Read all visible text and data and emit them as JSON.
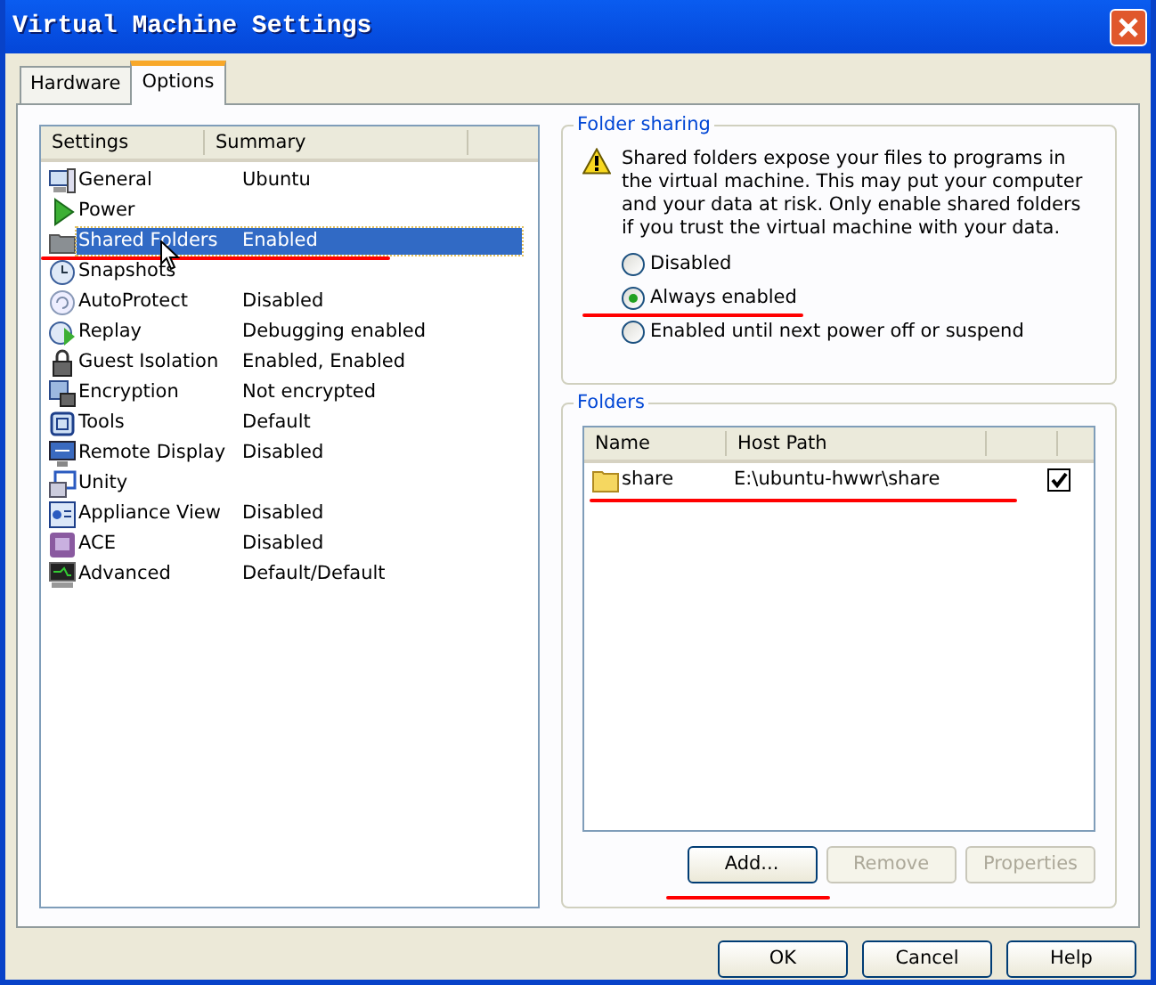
{
  "window": {
    "title": "Virtual Machine Settings"
  },
  "tabs": [
    {
      "label": "Hardware",
      "selected": false
    },
    {
      "label": "Options",
      "selected": true
    }
  ],
  "settings": {
    "columns": [
      "Settings",
      "Summary"
    ],
    "rows": [
      {
        "name": "General",
        "summary": "Ubuntu",
        "selected": false,
        "underlined": false
      },
      {
        "name": "Power",
        "selected": false,
        "underlined": false
      },
      {
        "name": "Shared Folders",
        "summary": "Enabled",
        "selected": true,
        "underlined": true
      },
      {
        "name": "Snapshots",
        "selected": false,
        "underlined": false
      },
      {
        "name": "AutoProtect",
        "summary": "Disabled",
        "selected": false,
        "underlined": false
      },
      {
        "name": "Replay",
        "summary": "Debugging enabled",
        "selected": false,
        "underlined": false
      },
      {
        "name": "Guest Isolation",
        "summary": "Enabled, Enabled",
        "selected": false,
        "underlined": false
      },
      {
        "name": "Encryption",
        "summary": "Not encrypted",
        "selected": false,
        "underlined": false
      },
      {
        "name": "Tools",
        "summary": "Default",
        "selected": false,
        "underlined": false
      },
      {
        "name": "Remote Display",
        "summary": "Disabled",
        "selected": false,
        "underlined": false
      },
      {
        "name": "Unity",
        "selected": false,
        "underlined": false
      },
      {
        "name": "Appliance View",
        "summary": "Disabled",
        "selected": false,
        "underlined": false
      },
      {
        "name": "ACE",
        "summary": "Disabled",
        "selected": false,
        "underlined": false
      },
      {
        "name": "Advanced",
        "summary": "Default/Default",
        "selected": false,
        "underlined": false
      }
    ]
  },
  "folder_sharing": {
    "title": "Folder sharing",
    "warning": "Shared folders expose your files to programs in the virtual machine. This may put your computer and your data at risk. Only enable shared folders if you trust the virtual machine with your data.",
    "options": [
      {
        "label": "Disabled",
        "selected": false,
        "underlined": false
      },
      {
        "label": "Always enabled",
        "selected": true,
        "underlined": true
      },
      {
        "label": "Enabled until next power off or suspend",
        "selected": false,
        "underlined": false
      }
    ]
  },
  "folders": {
    "title": "Folders",
    "columns": [
      "Name",
      "Host Path"
    ],
    "rows": [
      {
        "name": "share",
        "host_path": "E:\\ubuntu-hwwr\\share",
        "checked": true,
        "underlined": true
      }
    ],
    "buttons": [
      {
        "label": "Add...",
        "disabled": false,
        "underlined": true
      },
      {
        "label": "Remove",
        "disabled": true,
        "underlined": false
      },
      {
        "label": "Properties",
        "disabled": true,
        "underlined": false
      }
    ]
  },
  "buttons": [
    {
      "label": "OK"
    },
    {
      "label": "Cancel"
    },
    {
      "label": "Help"
    }
  ]
}
